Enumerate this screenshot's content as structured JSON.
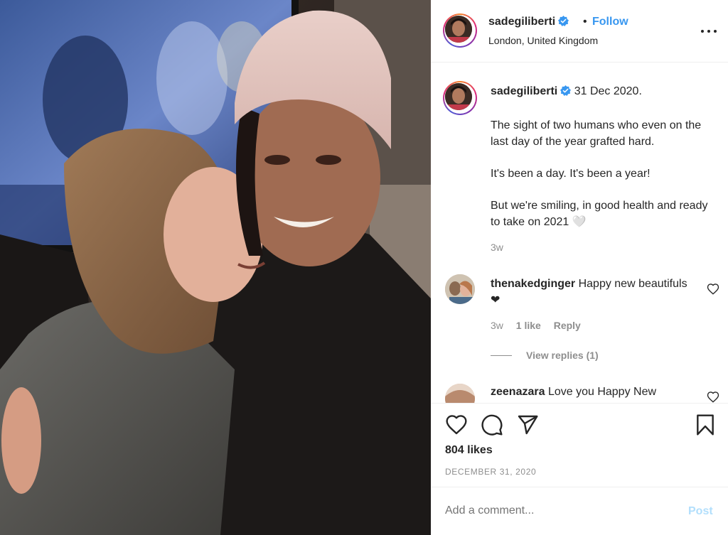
{
  "post": {
    "username": "sadegiliberti",
    "dot": "•",
    "follow_label": "Follow",
    "location": "London, United Kingdom"
  },
  "caption": {
    "username": "sadegiliberti",
    "date_text": "31 Dec 2020.",
    "paragraphs": [
      "The sight of two humans who even on the last day of the year grafted hard.",
      "It's been a day. It's been a year!",
      "But we're smiling, in good health and ready to take on 2021 🤍"
    ],
    "time": "3w"
  },
  "comments": [
    {
      "username": "thenakedginger",
      "text": " Happy new beautifuls ❤",
      "time": "3w",
      "likes": "1 like",
      "reply_label": "Reply",
      "view_replies": "View replies (1)"
    },
    {
      "username": "zeenazara",
      "text": " Love you Happy New"
    }
  ],
  "actions": {
    "likes": "804 likes",
    "date": "DECEMBER 31, 2020"
  },
  "add_comment": {
    "placeholder": "Add a comment...",
    "post_label": "Post"
  },
  "colors": {
    "accent": "#3897f0",
    "post_disabled": "#b2dffc",
    "muted": "#8e8e8e"
  },
  "icons": [
    "verified-badge-icon",
    "more-options-icon",
    "heart-icon",
    "comment-icon",
    "share-icon",
    "bookmark-icon"
  ]
}
